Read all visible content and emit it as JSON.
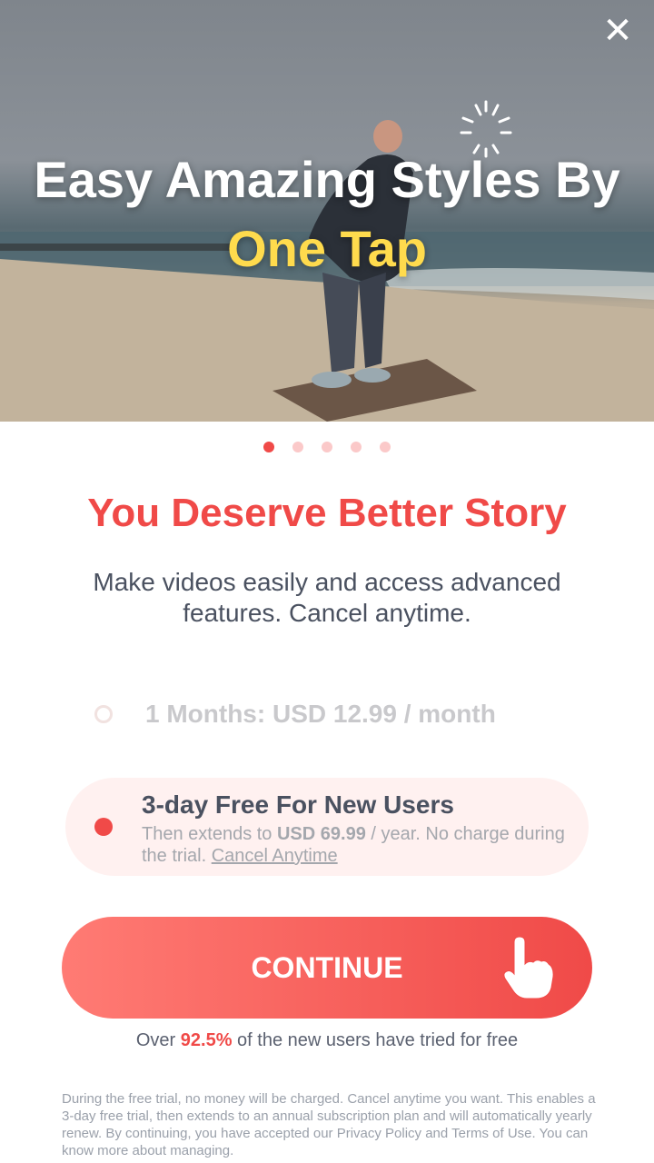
{
  "hero": {
    "title_line1": "Easy Amazing Styles By",
    "title_line2": "One Tap",
    "close_icon": "✕"
  },
  "pager": {
    "count": 5,
    "active_index": 0
  },
  "headline": "You Deserve Better Story",
  "subline": "Make videos easily and access advanced features. Cancel anytime.",
  "plans": [
    {
      "label": "1 Months: USD 12.99 / month",
      "selected": false
    },
    {
      "title": "3-day Free For New Users",
      "desc_prefix": "Then extends to ",
      "desc_price": "USD 69.99",
      "desc_suffix": " / year. No charge during the trial. ",
      "desc_link": "Cancel Anytime",
      "selected": true
    }
  ],
  "cta": {
    "label": "CONTINUE"
  },
  "stat": {
    "prefix": "Over ",
    "value": "92.5%",
    "suffix": " of the new users have tried for free"
  },
  "legal": "During the free trial, no money will be charged. Cancel anytime you want. This enables a 3-day free trial, then extends to an annual subscription plan and will automatically yearly renew. By continuing, you have accepted our Privacy Policy and Terms of Use. You can know more about managing.",
  "colors": {
    "accent": "#f04a48",
    "highlight": "#ffdb4d",
    "text_dark": "#4a5160"
  }
}
